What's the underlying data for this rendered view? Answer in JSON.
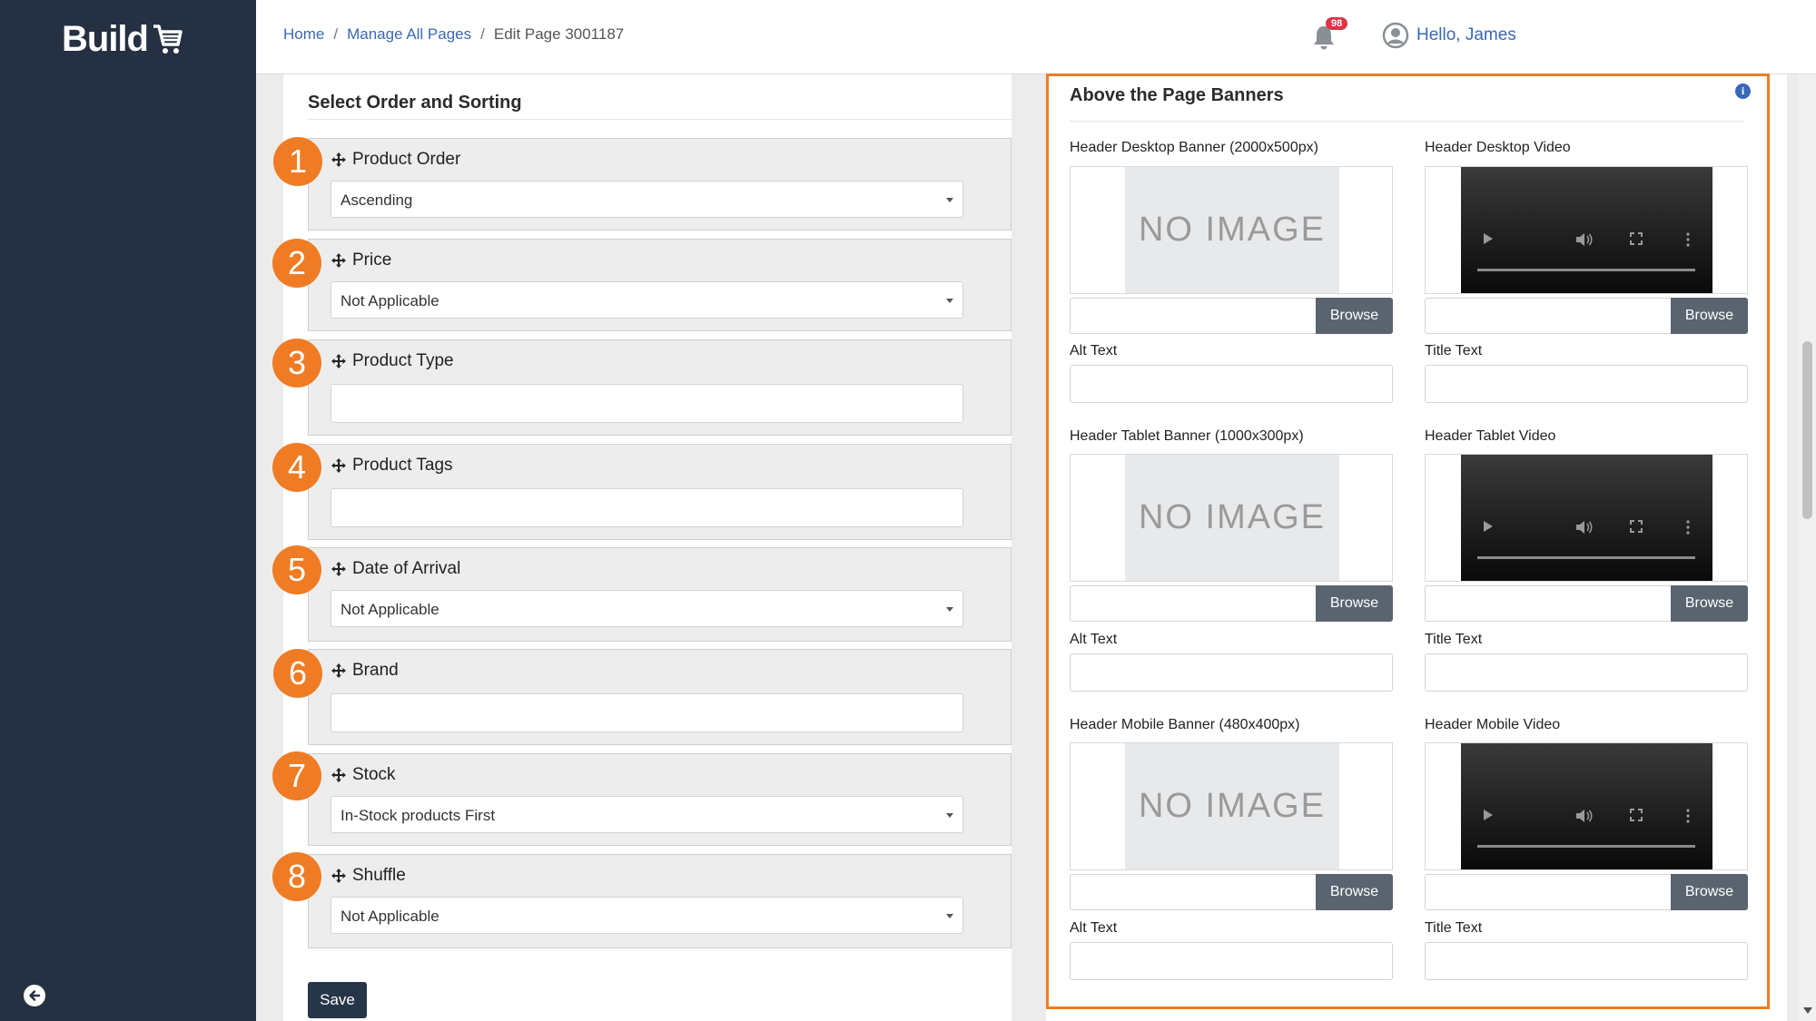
{
  "brand": {
    "logo_text": "Build",
    "accent": "#ef7c25",
    "sidebar_color": "#253042"
  },
  "breadcrumb": {
    "home": "Home",
    "manage": "Manage All Pages",
    "current": "Edit Page 3001187"
  },
  "notifications": {
    "count": "98",
    "icon": "bell-icon"
  },
  "user": {
    "greeting": "Hello, James",
    "icon": "user-circle-icon"
  },
  "sorting": {
    "title": "Select Order and Sorting",
    "items": [
      {
        "number": "1",
        "label": "Product Order",
        "value": "Ascending",
        "type": "select"
      },
      {
        "number": "2",
        "label": "Price",
        "value": "Not Applicable",
        "type": "select"
      },
      {
        "number": "3",
        "label": "Product Type",
        "value": "",
        "type": "input"
      },
      {
        "number": "4",
        "label": "Product Tags",
        "value": "",
        "type": "input"
      },
      {
        "number": "5",
        "label": "Date of Arrival",
        "value": "Not Applicable",
        "type": "select"
      },
      {
        "number": "6",
        "label": "Brand",
        "value": "",
        "type": "input"
      },
      {
        "number": "7",
        "label": "Stock",
        "value": "In-Stock products First",
        "type": "select"
      },
      {
        "number": "8",
        "label": "Shuffle",
        "value": "Not Applicable",
        "type": "select"
      }
    ],
    "save_label": "Save"
  },
  "banners": {
    "title": "Above the Page Banners",
    "no_image_text": "NO IMAGE",
    "browse_label": "Browse",
    "rows": [
      {
        "banner_label": "Header Desktop Banner (2000x500px)",
        "video_label": "Header Desktop Video",
        "alt_label": "Alt Text",
        "title_label": "Title Text"
      },
      {
        "banner_label": "Header Tablet Banner (1000x300px)",
        "video_label": "Header Tablet Video",
        "alt_label": "Alt Text",
        "title_label": "Title Text"
      },
      {
        "banner_label": "Header Mobile Banner (480x400px)",
        "video_label": "Header Mobile Video",
        "alt_label": "Alt Text",
        "title_label": "Title Text"
      }
    ]
  }
}
